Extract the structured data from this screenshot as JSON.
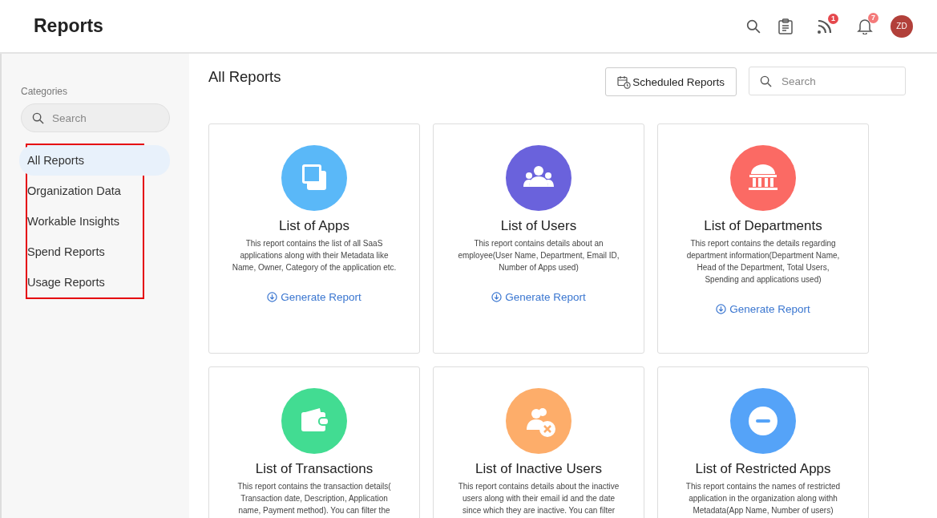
{
  "header": {
    "title": "Reports",
    "feed_badge": "1",
    "notification_badge": "7",
    "avatar": "ZD"
  },
  "sidebar": {
    "heading": "Categories",
    "search": {
      "placeholder": "Search"
    },
    "items": [
      {
        "label": "All Reports",
        "selected": true
      },
      {
        "label": "Organization Data",
        "selected": false
      },
      {
        "label": "Workable Insights",
        "selected": false
      },
      {
        "label": "Spend Reports",
        "selected": false
      },
      {
        "label": "Usage Reports",
        "selected": false
      }
    ]
  },
  "main": {
    "title": "All Reports",
    "scheduled_button": "Scheduled Reports",
    "search": {
      "placeholder": "Search"
    }
  },
  "cards": [
    {
      "kind": "apps",
      "color": "#5ab8f8",
      "title": "List of Apps",
      "description": [
        "This report contains the list of all SaaS",
        "applications along with their Metadata like",
        "Name, Owner, Category of the application etc."
      ],
      "action": "Generate Report"
    },
    {
      "kind": "users",
      "color": "#6a62dc",
      "title": "List of Users",
      "description": [
        "This report contains details about an",
        "employee(User Name, Department, Email ID,",
        "Number of Apps used)"
      ],
      "action": "Generate Report"
    },
    {
      "kind": "departments",
      "color": "#fb6a64",
      "title": "List of Departments",
      "description": [
        "This report contains the details regarding",
        "department information(Department Name,",
        "Head of the Department, Total Users,",
        "Spending and applications used)"
      ],
      "action": "Generate Report"
    },
    {
      "kind": "transactions",
      "color": "#42dc92",
      "title": "List of Transactions",
      "description": [
        "This report contains the transaction details(",
        "Transaction date, Description, Application",
        "name, Payment method). You can filter the"
      ]
    },
    {
      "kind": "inactive",
      "color": "#fdad6a",
      "title": "List of Inactive Users",
      "description": [
        "This report contains details about the inactive",
        "users along with their email id and the date",
        "since which they are inactive. You can filter"
      ]
    },
    {
      "kind": "restricted",
      "color": "#55a3f8",
      "title": "List of Restricted Apps",
      "description": [
        "This report contains the names of restricted",
        "application in the organization along withh",
        "Metadata(App Name, Number of users)"
      ]
    }
  ]
}
